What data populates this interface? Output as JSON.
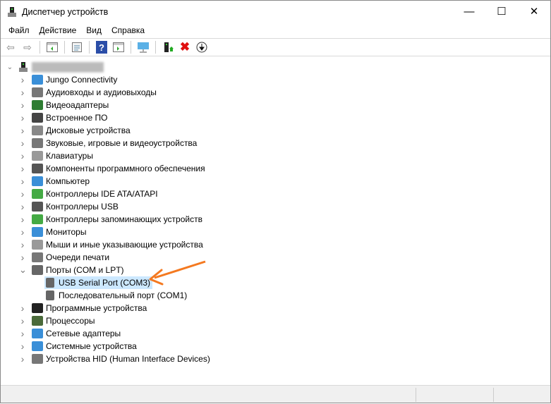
{
  "window": {
    "title": "Диспетчер устройств",
    "minimize": "—",
    "maximize": "☐",
    "close": "✕"
  },
  "menu": [
    "Файл",
    "Действие",
    "Вид",
    "Справка"
  ],
  "tree": {
    "root": "████████████",
    "categories": [
      {
        "label": "Jungo Connectivity",
        "icon": "monitor-icon"
      },
      {
        "label": "Аудиовходы и аудиовыходы",
        "icon": "speaker-icon"
      },
      {
        "label": "Видеоадаптеры",
        "icon": "display-adapter-icon"
      },
      {
        "label": "Встроенное ПО",
        "icon": "firmware-icon"
      },
      {
        "label": "Дисковые устройства",
        "icon": "disk-icon"
      },
      {
        "label": "Звуковые, игровые и видеоустройства",
        "icon": "speaker-icon"
      },
      {
        "label": "Клавиатуры",
        "icon": "keyboard-icon"
      },
      {
        "label": "Компоненты программного обеспечения",
        "icon": "software-component-icon"
      },
      {
        "label": "Компьютер",
        "icon": "computer-icon"
      },
      {
        "label": "Контроллеры IDE ATA/ATAPI",
        "icon": "ide-controller-icon"
      },
      {
        "label": "Контроллеры USB",
        "icon": "usb-icon"
      },
      {
        "label": "Контроллеры запоминающих устройств",
        "icon": "storage-controller-icon"
      },
      {
        "label": "Мониторы",
        "icon": "monitor-icon"
      },
      {
        "label": "Мыши и иные указывающие устройства",
        "icon": "mouse-icon"
      },
      {
        "label": "Очереди печати",
        "icon": "printer-icon"
      },
      {
        "label": "Порты (COM и LPT)",
        "icon": "port-icon",
        "expanded": true
      },
      {
        "label": "Программные устройства",
        "icon": "software-device-icon"
      },
      {
        "label": "Процессоры",
        "icon": "cpu-icon"
      },
      {
        "label": "Сетевые адаптеры",
        "icon": "network-icon"
      },
      {
        "label": "Системные устройства",
        "icon": "system-icon"
      },
      {
        "label": "Устройства HID (Human Interface Devices)",
        "icon": "hid-icon"
      }
    ],
    "ports": [
      {
        "label": "USB Serial Port (COM3)",
        "selected": true
      },
      {
        "label": "Последовательный порт (COM1)"
      }
    ]
  },
  "colors": {
    "selection": "#cce8ff",
    "arrow": "#f47920"
  }
}
